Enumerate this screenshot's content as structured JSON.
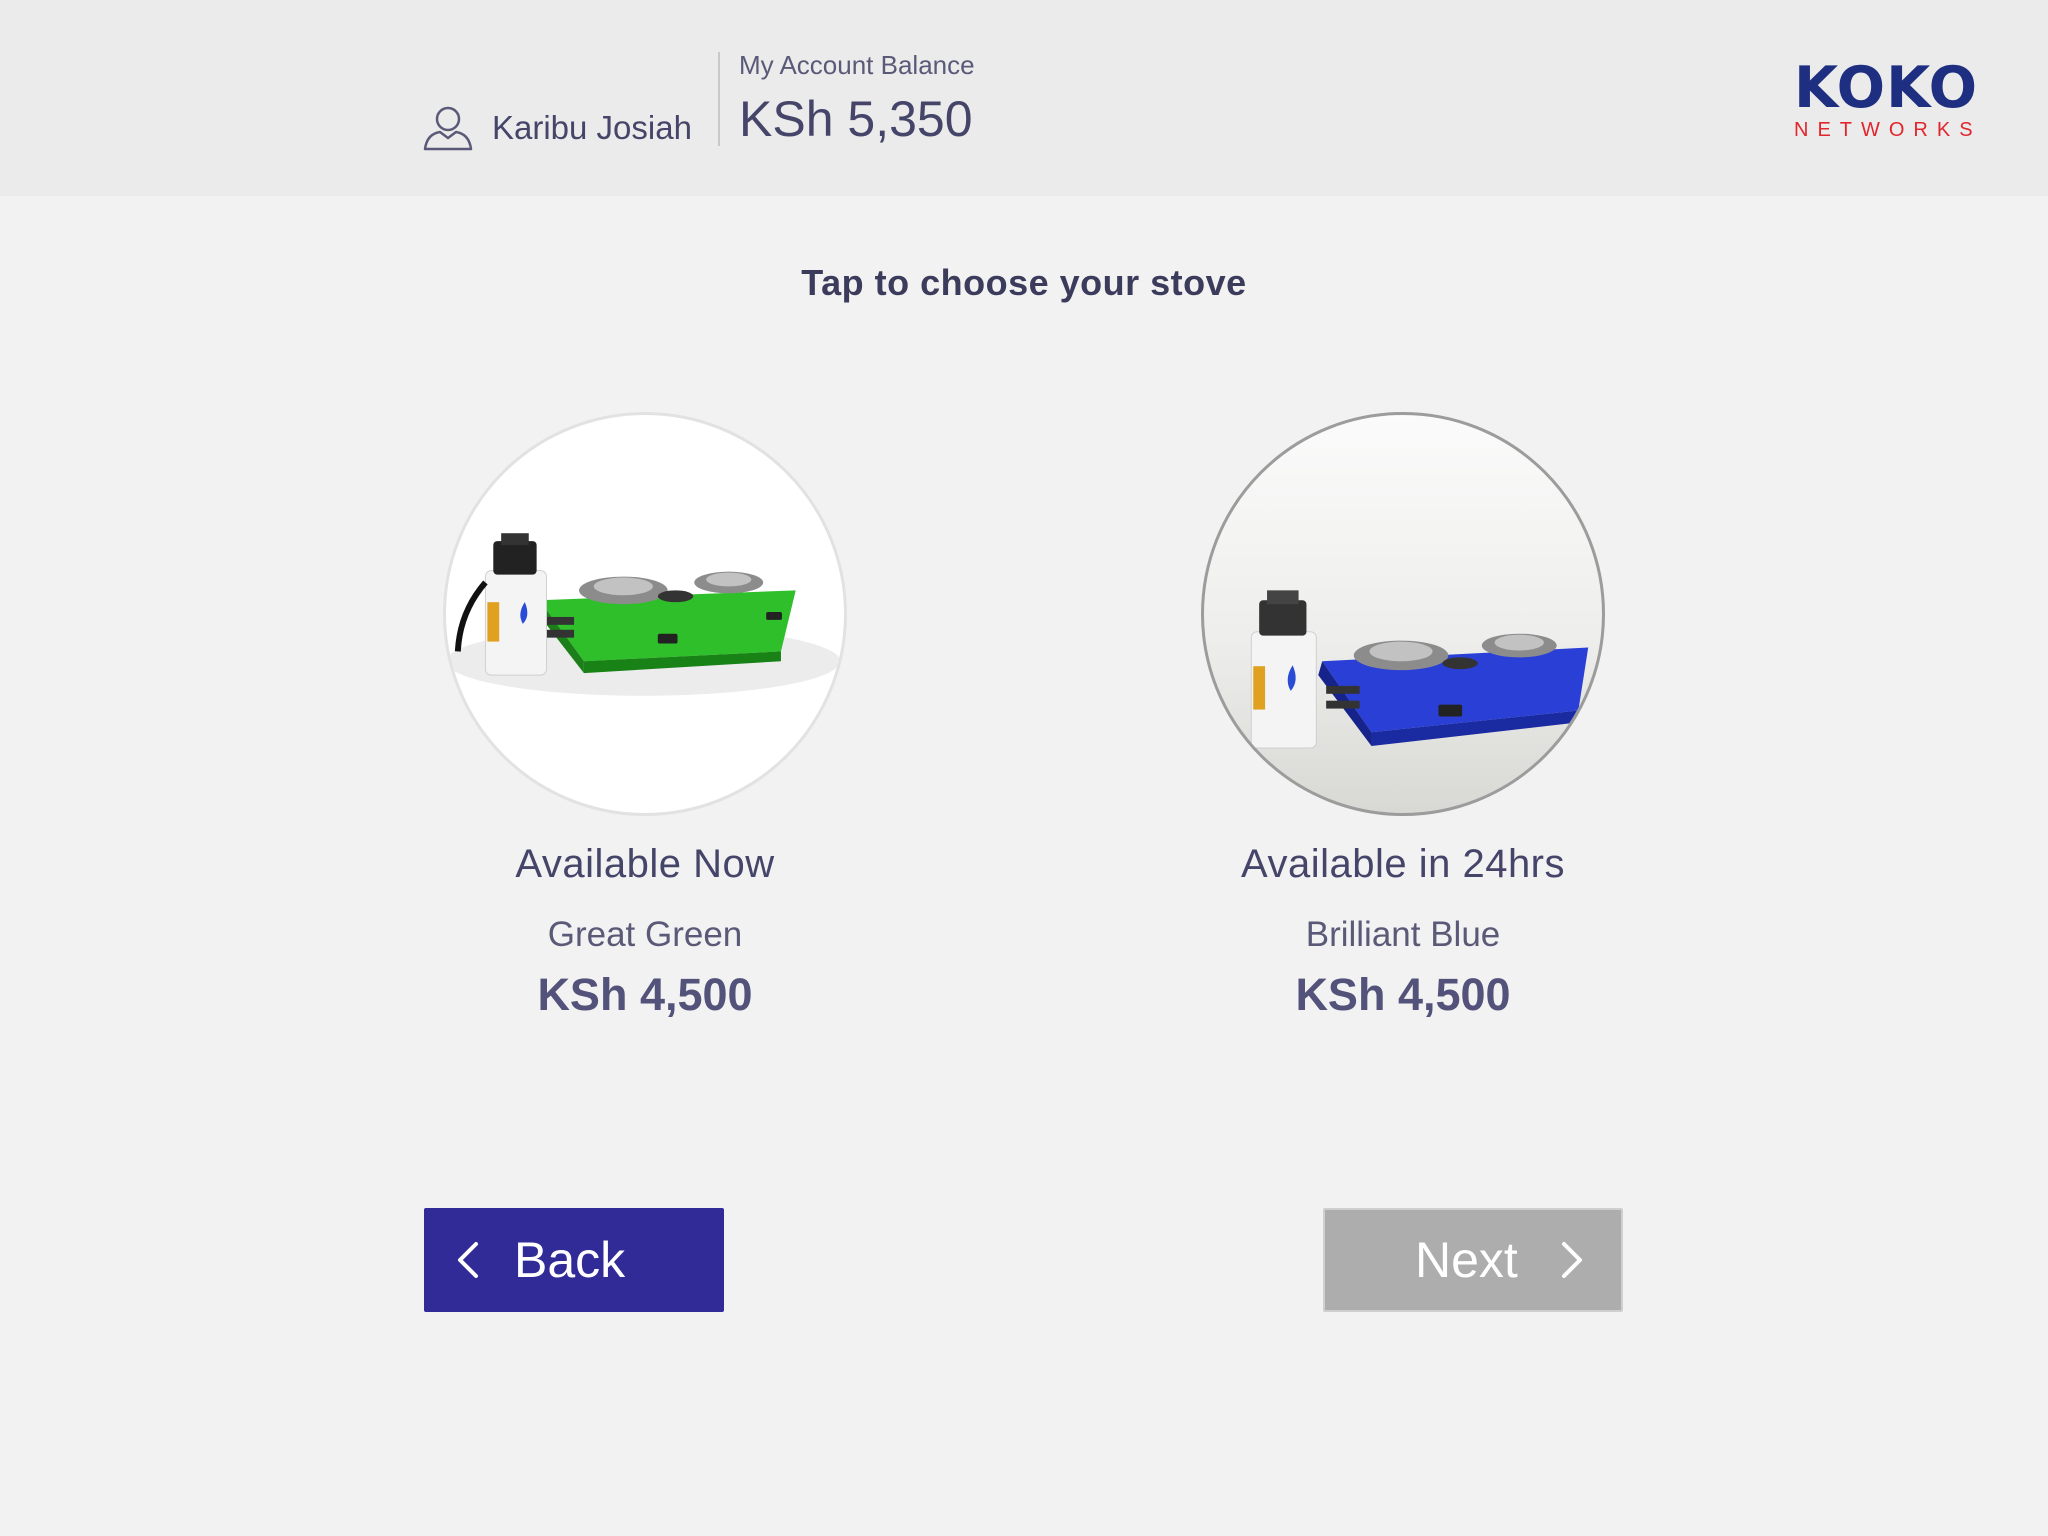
{
  "header": {
    "greeting": "Karibu Josiah",
    "balance_label": "My Account Balance",
    "balance_value": "KSh 5,350",
    "logo": {
      "primary": "KOKO",
      "secondary": "NETWORKS"
    }
  },
  "main": {
    "prompt": "Tap to choose your stove",
    "options": [
      {
        "availability": "Available Now",
        "model": "Great Green",
        "price": "KSh 4,500",
        "color": "#2fbf2a"
      },
      {
        "availability": "Available in 24hrs",
        "model": "Brilliant Blue",
        "price": "KSh 4,500",
        "color": "#2a3fd6"
      }
    ]
  },
  "nav": {
    "back_label": "Back",
    "next_label": "Next"
  },
  "icons": {
    "user": "user-icon",
    "back": "chevron-left-icon",
    "next": "chevron-right-icon"
  },
  "colors": {
    "brand_navy": "#1e2f82",
    "brand_red": "#e2262e",
    "back_button": "#312b98",
    "next_button_disabled": "#adadad"
  }
}
